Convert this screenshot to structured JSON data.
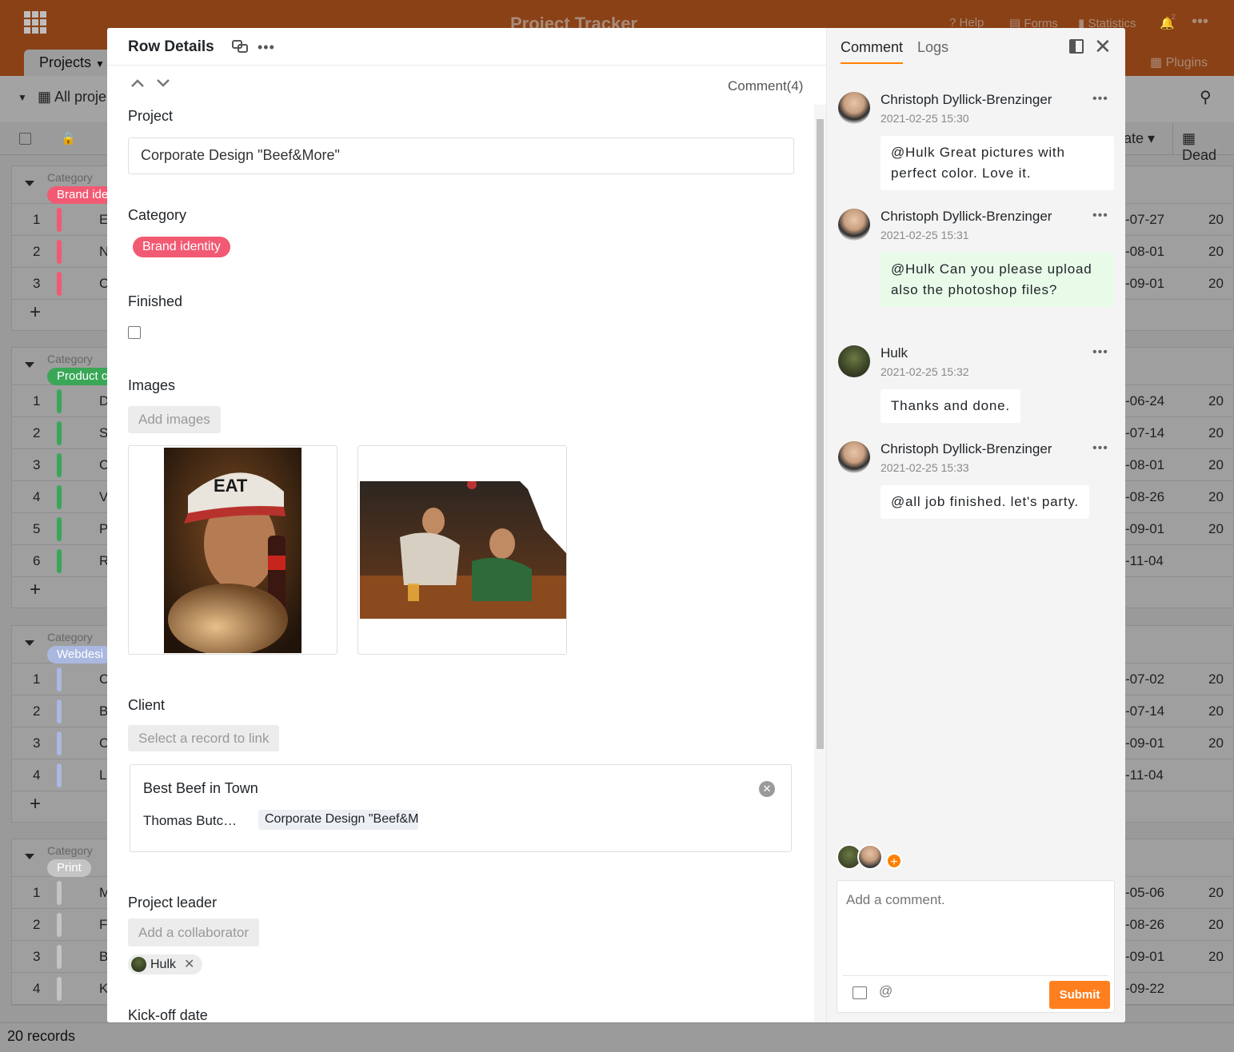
{
  "app": {
    "title": "Project Tracker",
    "help": "Help",
    "forms": "Forms",
    "statistics": "Statistics",
    "notification_count": "2",
    "plugins": "Plugins"
  },
  "table": {
    "tab": "Projects",
    "view": "All proje",
    "col_date": "ate",
    "col_deadline": "Dead",
    "record_count": "20 records",
    "groups": [
      {
        "caption": "Category",
        "tag": "Brand ide",
        "color": "#f25a73",
        "rows": [
          {
            "n": "1",
            "i": "E",
            "d": "-07-27",
            "y": "20"
          },
          {
            "n": "2",
            "i": "N",
            "d": "-08-01",
            "y": "20"
          },
          {
            "n": "3",
            "i": "C",
            "d": "-09-01",
            "y": "20"
          }
        ]
      },
      {
        "caption": "Category",
        "tag": "Product c",
        "color": "#3aa757",
        "rows": [
          {
            "n": "1",
            "i": "D",
            "d": "-06-24",
            "y": "20"
          },
          {
            "n": "2",
            "i": "S",
            "d": "-07-14",
            "y": "20"
          },
          {
            "n": "3",
            "i": "C",
            "d": "-08-01",
            "y": "20"
          },
          {
            "n": "4",
            "i": "V",
            "d": "-08-26",
            "y": "20"
          },
          {
            "n": "5",
            "i": "P",
            "d": "-09-01",
            "y": "20"
          },
          {
            "n": "6",
            "i": "R",
            "d": "-11-04",
            "y": ""
          }
        ]
      },
      {
        "caption": "Category",
        "tag": "Webdesi",
        "color": "#aab8e0",
        "rows": [
          {
            "n": "1",
            "i": "C",
            "d": "-07-02",
            "y": "20"
          },
          {
            "n": "2",
            "i": "B",
            "d": "-07-14",
            "y": "20"
          },
          {
            "n": "3",
            "i": "C",
            "d": "-09-01",
            "y": "20"
          },
          {
            "n": "4",
            "i": "L",
            "d": "-11-04",
            "y": ""
          }
        ]
      },
      {
        "caption": "Category",
        "tag": "Print",
        "color": "#c4c4c4",
        "rows": [
          {
            "n": "1",
            "i": "M",
            "d": "-05-06",
            "y": "20"
          },
          {
            "n": "2",
            "i": "F",
            "d": "-08-26",
            "y": "20"
          },
          {
            "n": "3",
            "i": "B",
            "d": "-09-01",
            "y": "20"
          },
          {
            "n": "4",
            "i": "K",
            "d": "-09-22",
            "y": ""
          }
        ]
      }
    ]
  },
  "modal": {
    "title": "Row Details",
    "comment_count": "Comment(4)",
    "labels": {
      "project": "Project",
      "category": "Category",
      "finished": "Finished",
      "images": "Images",
      "client": "Client",
      "project_leader": "Project leader",
      "kickoff": "Kick-off date"
    },
    "project_value": "Corporate Design \"Beef&More\"",
    "category_value": "Brand identity",
    "add_images": "Add images",
    "select_record": "Select a record to link",
    "client": {
      "name": "Best Beef in Town",
      "person": "Thomas Butc…",
      "linked": "Corporate Design \"Beef&M"
    },
    "add_collaborator": "Add a collaborator",
    "leader": "Hulk"
  },
  "comments_pane": {
    "tab_comment": "Comment",
    "tab_logs": "Logs",
    "comments": [
      {
        "author": "Christoph Dyllick-Brenzinger",
        "time": "2021-02-25 15:30",
        "text": "@Hulk Great pictures with perfect color. Love it.",
        "bg": "#ffffff"
      },
      {
        "author": "Christoph Dyllick-Brenzinger",
        "time": "2021-02-25 15:31",
        "text": "@Hulk Can you please upload also the photoshop files?",
        "bg": "#e8fbe9"
      },
      {
        "author": "Hulk",
        "time": "2021-02-25 15:32",
        "text": "Thanks and done.",
        "bg": "#ffffff"
      },
      {
        "author": "Christoph Dyllick-Brenzinger",
        "time": "2021-02-25 15:33",
        "text": "@all job finished. let's party.",
        "bg": "#ffffff"
      }
    ],
    "placeholder": "Add a comment.",
    "submit": "Submit"
  },
  "colors": {
    "accent": "#ff7f1f",
    "header_bg": "#e8611a",
    "brand_pill": "#f25a73"
  }
}
